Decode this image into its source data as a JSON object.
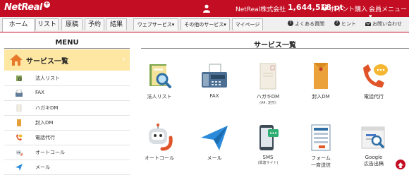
{
  "header": {
    "logo": "NetReal",
    "logo_plus": "+",
    "company": "NetReal株式会社",
    "points": "1,644,528 pt",
    "buy_icon": "+",
    "buy_label": "ポイント購入",
    "member_menu": "会員メニュー▾"
  },
  "tabs": [
    "ホーム",
    "リスト",
    "原稿",
    "予約",
    "結果",
    "ウェブサービス▾",
    "その他のサービス▾",
    "マイページ"
  ],
  "utility": {
    "faq": "よくある質問",
    "hint": "ヒント",
    "contact": "お問い合わせ"
  },
  "menu": {
    "title": "MENU",
    "active": "サービス一覧",
    "items": [
      "法人リスト",
      "FAX",
      "ハガキDM",
      "封入DM",
      "電話代行",
      "オートコール",
      "メール"
    ]
  },
  "services": {
    "title": "サービス一覧",
    "items": [
      {
        "name": "法人リスト",
        "sub": ""
      },
      {
        "name": "FAX",
        "sub": ""
      },
      {
        "name": "ハガキDM",
        "sub": "(A4, 定形)"
      },
      {
        "name": "封入DM",
        "sub": ""
      },
      {
        "name": "電話代行",
        "sub": ""
      },
      {
        "name": "オートコール",
        "sub": ""
      },
      {
        "name": "メール",
        "sub": ""
      },
      {
        "name": "SMS",
        "sub": "(関連サイト)"
      },
      {
        "name": "フォーム",
        "sub": "一斉送信"
      },
      {
        "name": "Google",
        "sub": "広告出稿"
      }
    ]
  },
  "colors": {
    "brand": "#c30d23",
    "menu_active_bg": "#fde7a3"
  }
}
